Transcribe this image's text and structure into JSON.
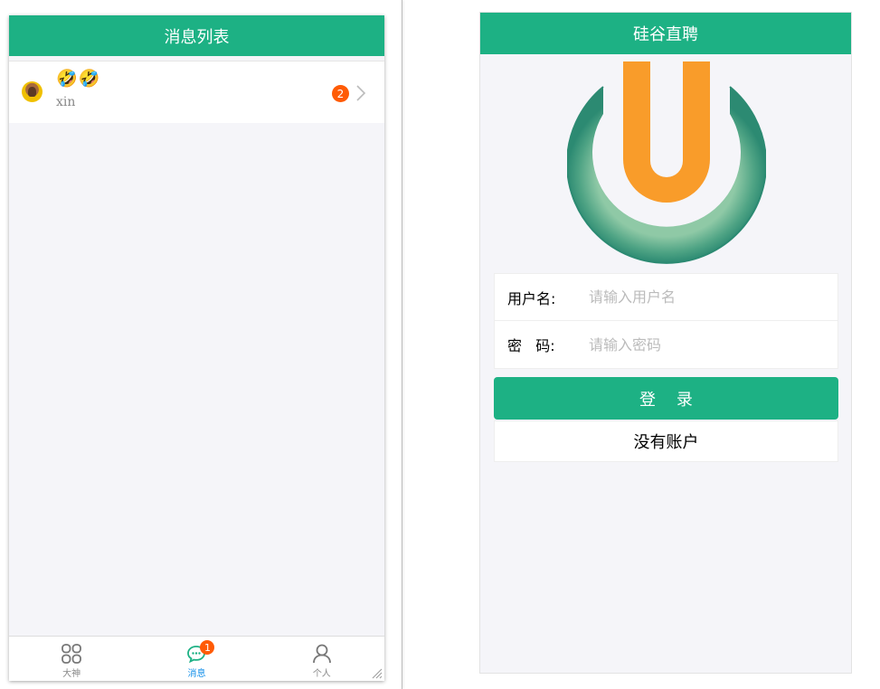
{
  "left": {
    "title": "消息列表",
    "messages": [
      {
        "content": "🤣🤣",
        "name": "xin",
        "unread": "2"
      }
    ],
    "tabs": [
      {
        "label": "大神",
        "icon": "grid-icon",
        "badge": ""
      },
      {
        "label": "消息",
        "icon": "chat-icon",
        "badge": "1"
      },
      {
        "label": "个人",
        "icon": "person-icon",
        "badge": ""
      }
    ]
  },
  "right": {
    "title": "硅谷直聘",
    "form": {
      "username_label": "用户名:",
      "username_placeholder": "请输入用户名",
      "password_label": "密   码:",
      "password_placeholder": "请输入密码"
    },
    "login_label": "登    录",
    "register_label": "没有账户"
  },
  "colors": {
    "brand": "#1db184",
    "badge": "#ff5b05",
    "active_tab": "#108ee9",
    "logo_orange": "#f99c2a",
    "logo_green": "#2c8a72"
  }
}
